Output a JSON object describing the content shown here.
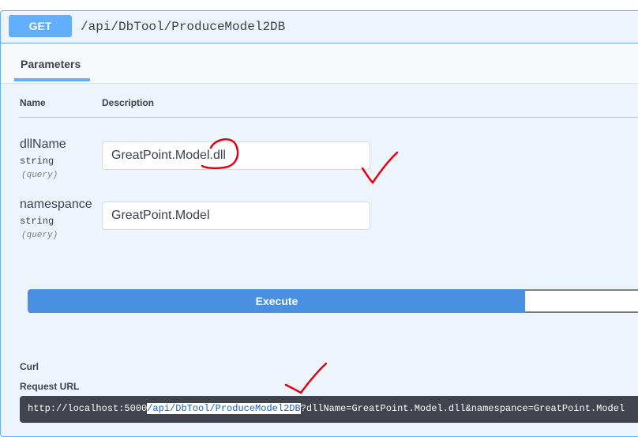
{
  "operation": {
    "method": "GET",
    "path": "/api/DbTool/ProduceModel2DB"
  },
  "tabs": [
    "Parameters"
  ],
  "columns": {
    "name": "Name",
    "description": "Description"
  },
  "parameters": [
    {
      "name": "dllName",
      "type": "string",
      "in": "(query)",
      "value": "GreatPoint.Model.dll"
    },
    {
      "name": "namespance",
      "type": "string",
      "in": "(query)",
      "value": "GreatPoint.Model"
    }
  ],
  "actions": {
    "execute": "Execute",
    "clear": ""
  },
  "responses": {
    "curl_label": "Curl",
    "request_url_label": "Request URL",
    "request_url": {
      "host": "http://localhost:5000",
      "path": "/api/DbTool/ProduceModel2DB",
      "query": "?dllName=GreatPoint.Model.dll&namespance=GreatPoint.Model"
    }
  },
  "annotations": {
    "color": "#e3000f",
    "marks": [
      "circle-around-dll",
      "checkmark",
      "checkmark"
    ]
  },
  "colors": {
    "get_accent": "#61affe",
    "execute_blue": "#4990e2",
    "url_bg": "#41444e"
  }
}
